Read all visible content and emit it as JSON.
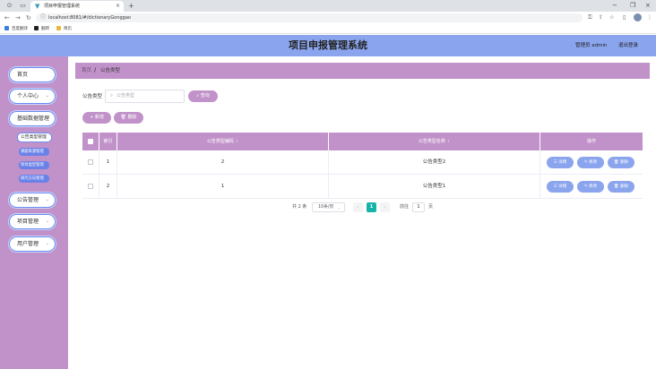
{
  "browser": {
    "tab_title": "项目申报管理系统",
    "tab_close": "×",
    "new_tab": "+",
    "url": "localhost:8081/#/dictionaryGonggao",
    "bookmarks": [
      "百度翻译",
      "翻转",
      "简历"
    ]
  },
  "header": {
    "title": "项目申报管理系统",
    "user": "管理员 admin",
    "logout": "退出登录"
  },
  "sidebar": {
    "items": [
      {
        "label": "首页",
        "has_chevron": false
      },
      {
        "label": "个人中心",
        "has_chevron": true
      },
      {
        "label": "基础数据管理",
        "has_chevron": true
      },
      {
        "label": "公告管理",
        "has_chevron": true
      },
      {
        "label": "项目管理",
        "has_chevron": true
      },
      {
        "label": "用户管理",
        "has_chevron": true
      }
    ],
    "chevron": "⌄",
    "sub_active": "公告类型管理",
    "sub_items": [
      "课题来源管理",
      "项目类型管理",
      "研究方向管理"
    ]
  },
  "breadcrumb": {
    "home": "首页",
    "separator": "/",
    "current": "公告类型"
  },
  "search": {
    "label": "公告类型",
    "placeholder": "公告类型",
    "button": "查询"
  },
  "toolbar": {
    "add": "+ 新增",
    "delete": "删除"
  },
  "table": {
    "columns": [
      "索引",
      "公告类型编码",
      "公告类型名称",
      "操作"
    ],
    "sort_glyph": "⇕",
    "rows": [
      {
        "index": "1",
        "code": "2",
        "name": "公告类型2"
      },
      {
        "index": "2",
        "code": "1",
        "name": "公告类型1"
      }
    ],
    "actions": [
      "详情",
      "修改",
      "删除"
    ]
  },
  "pagination": {
    "total": "共 2 条",
    "page_size": "10条/页",
    "prev": "‹",
    "next": "›",
    "current_page": "1",
    "goto_label": "前往",
    "goto_value": "1",
    "page_unit": "页"
  },
  "colors": {
    "header": "#8aa4ee",
    "sidebar": "#c192c9",
    "primary_button": "#c192c9",
    "action_button": "#8aa4ee",
    "active_page": "#16b4a8"
  }
}
